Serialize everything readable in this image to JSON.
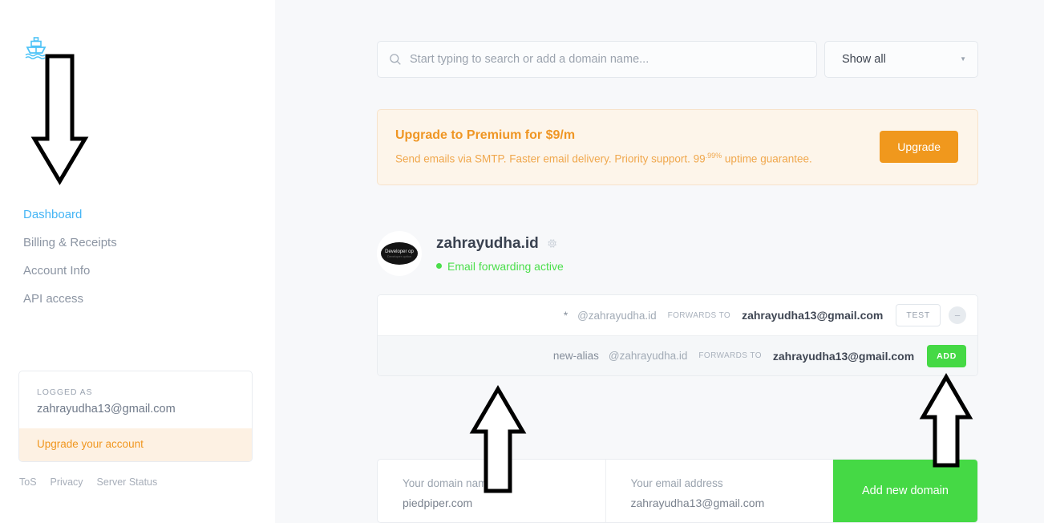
{
  "brand": {
    "logo_icon": "ship-logo-icon",
    "logo_color": "#4ec3f7"
  },
  "sidebar": {
    "items": [
      {
        "label": "Dashboard",
        "active": true
      },
      {
        "label": "Billing & Receipts",
        "active": false
      },
      {
        "label": "Account Info",
        "active": false
      },
      {
        "label": "API access",
        "active": false
      }
    ],
    "logged_as_label": "LOGGED AS",
    "logged_as_email": "zahrayudha13@gmail.com",
    "upgrade_link": "Upgrade your account",
    "footer_links": [
      "ToS",
      "Privacy",
      "Server Status"
    ]
  },
  "search": {
    "placeholder": "Start typing to search or add a domain name...",
    "value": "",
    "icon": "search-icon"
  },
  "filter": {
    "selected": "Show all",
    "options": [
      "Show all"
    ],
    "icon": "chevron-down-icon"
  },
  "banner": {
    "title": "Upgrade to Premium for $9/m",
    "subtitle_before": "Send emails via SMTP. Faster email delivery. Priority support. 99",
    "subtitle_sup": ".99%",
    "subtitle_after": " uptime guarantee.",
    "button_label": "Upgrade",
    "accent_color": "#f0981d",
    "background_color": "#fdf5ea"
  },
  "domain": {
    "name": "zahrayudha.id",
    "settings_icon": "gear-icon",
    "status": "Email forwarding active",
    "status_color": "#4ade4a",
    "avatar": {
      "name": "avatar",
      "line1": "Developer op",
      "line2": "Developer option"
    }
  },
  "aliases": {
    "forwards_label": "FORWARDS TO",
    "rows": [
      {
        "enabled": true,
        "alias": "*",
        "domain": "@zahrayudha.id",
        "target": "zahrayudha13@gmail.com",
        "test_label": "TEST",
        "disable_label": "−",
        "type": "existing"
      },
      {
        "enabled": false,
        "alias": "new-alias",
        "domain": "@zahrayudha.id",
        "target": "zahrayudha13@gmail.com",
        "add_label": "ADD",
        "type": "new"
      }
    ]
  },
  "new_domain": {
    "domain_label": "Your domain name",
    "domain_value": "piedpiper.com",
    "email_label": "Your email address",
    "email_value": "zahrayudha13@gmail.com",
    "submit_label": "Add new domain",
    "submit_color": "#45d945"
  },
  "annotations": {
    "arrow_down_sidebar": "arrow-down-annotation",
    "arrow_up_center": "arrow-up-annotation",
    "arrow_up_add": "arrow-up-annotation"
  }
}
